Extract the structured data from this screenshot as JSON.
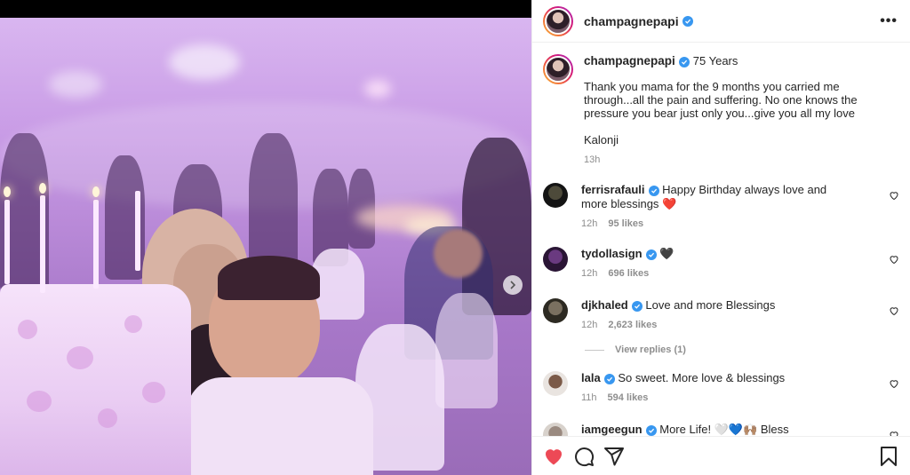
{
  "post": {
    "username": "champagnepapi",
    "caption_tag": "75 Years",
    "caption_text": "Thank you mama for the 9 months you carried me through...all the pain and suffering. No one knows the pressure you bear just only you...give you all my love",
    "caption_sign": "Kalonji",
    "caption_time": "13h"
  },
  "icons": {
    "more": "more-options-icon",
    "verified": "verified-badge-icon",
    "next": "chevron-right-icon",
    "like": "heart-icon",
    "comment": "comment-icon",
    "share": "paper-plane-icon",
    "save": "bookmark-icon"
  },
  "colors": {
    "verified": "#3897f0",
    "liked": "#ed4956",
    "meta": "#8e8e8e"
  },
  "header": {
    "more_label": "•••"
  },
  "comments": [
    {
      "username": "ferrisrafauli",
      "text": "Happy Birthday always love and more blessings ❤️",
      "time": "12h",
      "likes": "95 likes"
    },
    {
      "username": "tydollasign",
      "text": "🖤",
      "time": "12h",
      "likes": "696 likes"
    },
    {
      "username": "djkhaled",
      "text": "Love and more Blessings",
      "time": "12h",
      "likes": "2,623 likes",
      "replies": "View replies (1)"
    },
    {
      "username": "lala",
      "text": "So sweet. More love & blessings",
      "time": "11h",
      "likes": "594 likes"
    },
    {
      "username": "iamgeegun",
      "text": "More Life! 🤍💙🙌🏽 Bless",
      "time": "",
      "likes": ""
    }
  ]
}
